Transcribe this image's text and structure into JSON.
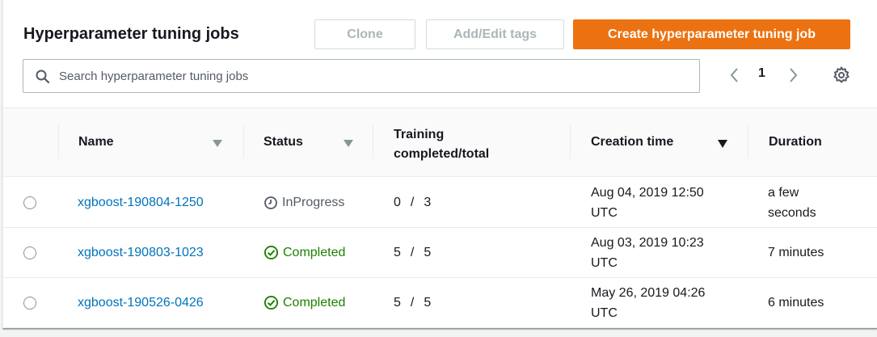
{
  "header": {
    "title": "Hyperparameter tuning jobs",
    "clone_label": "Clone",
    "tags_label": "Add/Edit tags",
    "create_label": "Create hyperparameter tuning job"
  },
  "search": {
    "placeholder": "Search hyperparameter tuning jobs",
    "value": ""
  },
  "pagination": {
    "current_page": "1"
  },
  "columns": {
    "name": "Name",
    "status": "Status",
    "training_line1": "Training",
    "training_line2": "completed/total",
    "creation_time": "Creation time",
    "duration": "Duration"
  },
  "rows": [
    {
      "name": "xgboost-190804-1250",
      "status": "InProgress",
      "status_icon": "clock-icon",
      "completed": "0",
      "total": "3",
      "created_line1": "Aug 04, 2019 12:50",
      "created_line2": "UTC",
      "duration_line1": "a few",
      "duration_line2": "seconds"
    },
    {
      "name": "xgboost-190803-1023",
      "status": "Completed",
      "status_icon": "check-circle-icon",
      "completed": "5",
      "total": "5",
      "created_line1": "Aug 03, 2019 10:23",
      "created_line2": "UTC",
      "duration_line1": "7 minutes",
      "duration_line2": ""
    },
    {
      "name": "xgboost-190526-0426",
      "status": "Completed",
      "status_icon": "check-circle-icon",
      "completed": "5",
      "total": "5",
      "created_line1": "May 26, 2019 04:26",
      "created_line2": "UTC",
      "duration_line1": "6 minutes",
      "duration_line2": ""
    }
  ],
  "colors": {
    "primary": "#ec7211",
    "link": "#0073bb",
    "success": "#1d8102",
    "in_progress": "#545b64"
  }
}
